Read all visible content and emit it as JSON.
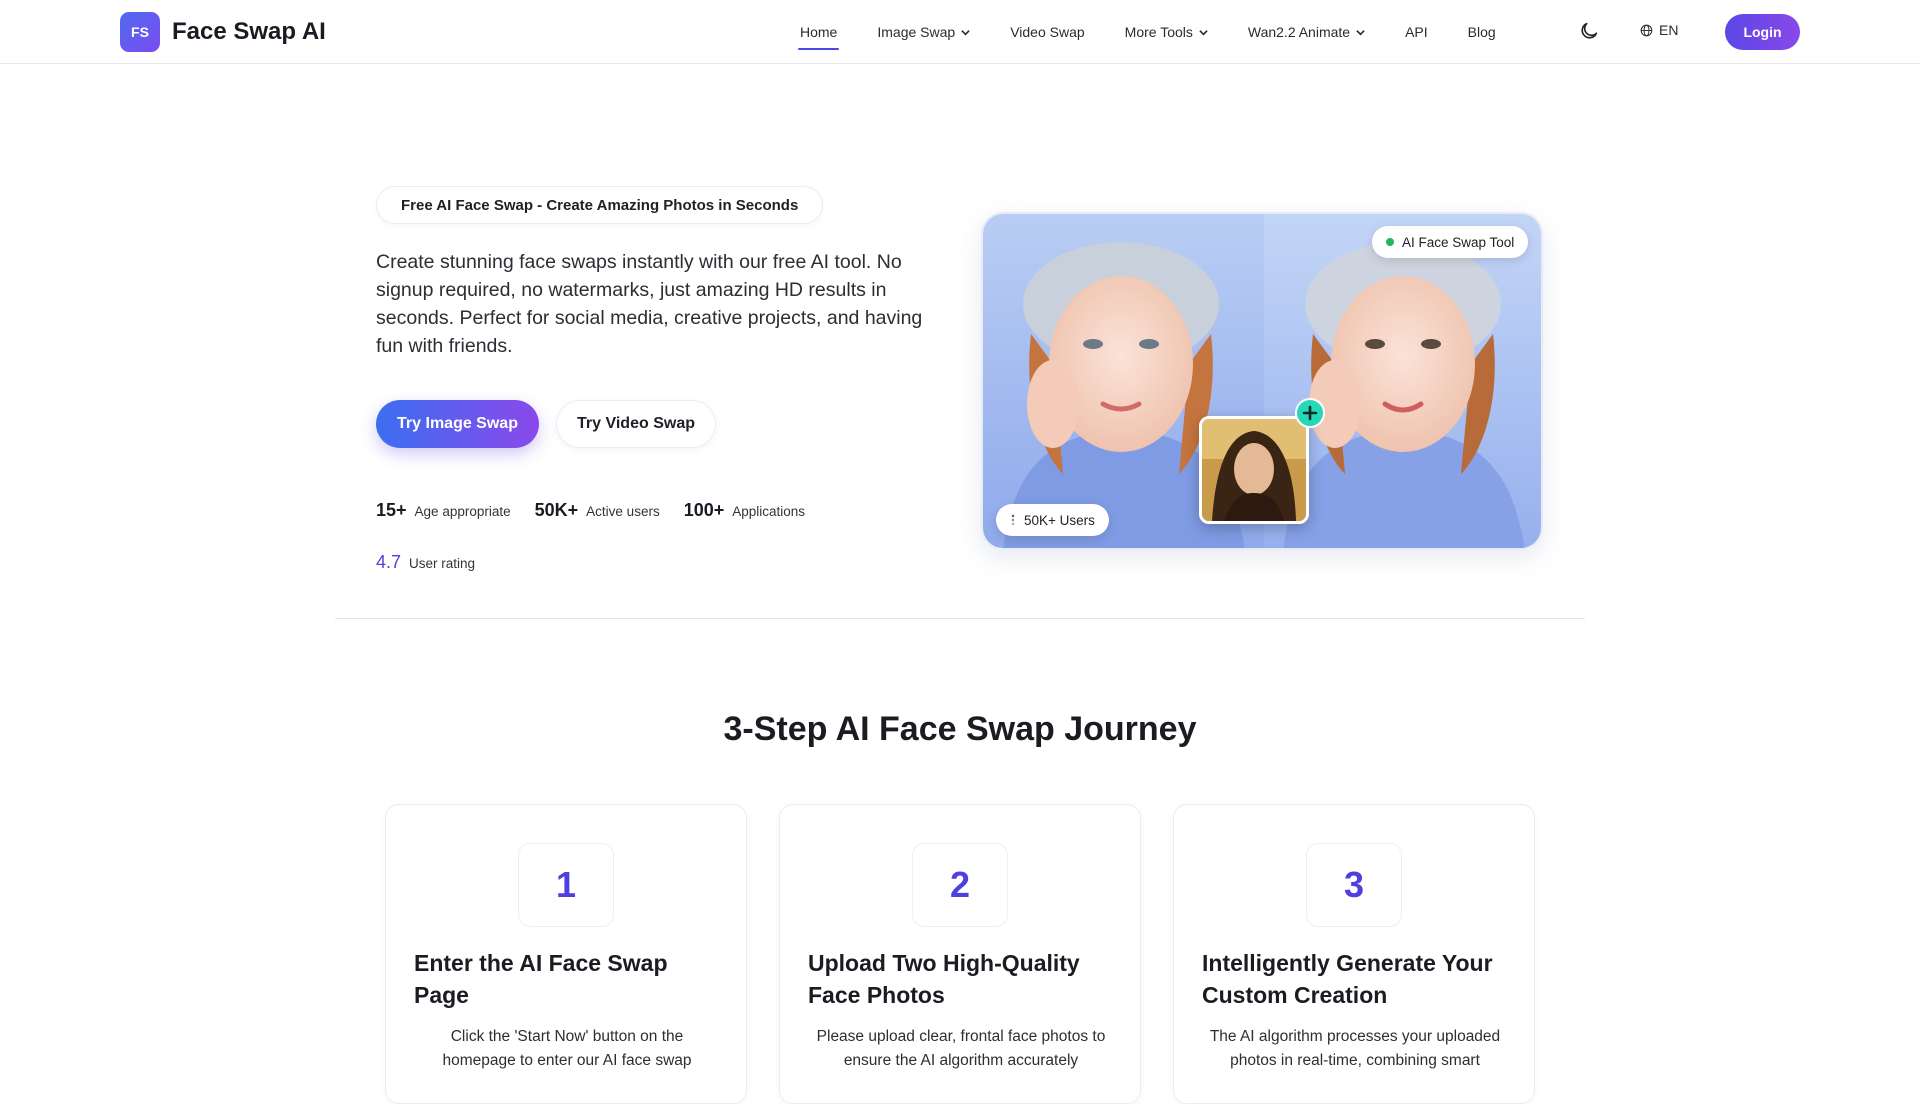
{
  "brand": {
    "badge": "FS",
    "name": "Face Swap AI"
  },
  "nav": {
    "items": [
      {
        "label": "Home",
        "active": true,
        "dropdown": false
      },
      {
        "label": "Image Swap",
        "dropdown": true
      },
      {
        "label": "Video Swap",
        "dropdown": false
      },
      {
        "label": "More Tools",
        "dropdown": true
      },
      {
        "label": "Wan2.2 Animate",
        "dropdown": true
      },
      {
        "label": "API",
        "dropdown": false
      },
      {
        "label": "Blog",
        "dropdown": false
      }
    ],
    "theme_icon": "moon-icon",
    "language": "EN",
    "login": "Login"
  },
  "hero": {
    "badge": "Free AI Face Swap - Create Amazing Photos in Seconds",
    "description": "Create stunning face swaps instantly with our free AI tool. No signup required, no watermarks, just amazing HD results in seconds. Perfect for social media, creative projects, and having fun with friends.",
    "primary_button": "Try Image Swap",
    "secondary_button": "Try Video Swap",
    "stats": [
      {
        "value": "15+",
        "label": "Age appropriate"
      },
      {
        "value": "50K+",
        "label": "Active users"
      },
      {
        "value": "100+",
        "label": "Applications"
      }
    ],
    "rating": {
      "value": "4.7",
      "label": "User rating"
    },
    "image_tag": "AI Face Swap Tool",
    "users_tag": "50K+ Users"
  },
  "steps": {
    "title": "3-Step AI Face Swap Journey",
    "items": [
      {
        "number": "1",
        "title": "Enter the AI Face Swap Page",
        "text": "Click the 'Start Now' button on the homepage to enter our AI face swap"
      },
      {
        "number": "2",
        "title": "Upload Two High-Quality Face Photos",
        "text": "Please upload clear, frontal face photos to ensure the AI algorithm accurately"
      },
      {
        "number": "3",
        "title": "Intelligently Generate Your Custom Creation",
        "text": "The AI algorithm processes your uploaded photos in real-time, combining smart"
      }
    ]
  },
  "colors": {
    "accent": "#4f46e5",
    "gradient_start": "#3b6ff0",
    "gradient_end": "#8b48ea",
    "plus_badge": "#26d7b8"
  }
}
